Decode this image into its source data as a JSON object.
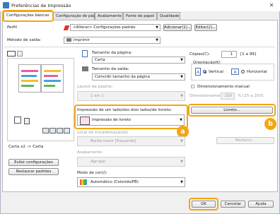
{
  "window": {
    "title": "Preferências de Impressão",
    "close_glyph": "✕"
  },
  "tabs": [
    {
      "label": "Configurações básicas",
      "active": true
    },
    {
      "label": "Configuração de página"
    },
    {
      "label": "Acabamento"
    },
    {
      "label": "Fonte de papel"
    },
    {
      "label": "Qualidade"
    }
  ],
  "profile": {
    "label": "Perfil",
    "value": "<Alterar> Configurações padrão",
    "add_button": "Adicionar(1)...",
    "edit_button": "Editar(2)..."
  },
  "output_method": {
    "label": "Método de saída:",
    "value": "Imprimir"
  },
  "preview": {
    "caption": "Carta x2 -> Carta",
    "settings_view_button": "Exibir configurações",
    "restore_defaults_button": "Restaurar padrões"
  },
  "page_size": {
    "label": "Tamanho da página:",
    "value": "Carta"
  },
  "output_size": {
    "label": "Tamanho da saída:",
    "value": "Coincidir tamanho da página"
  },
  "copies": {
    "label": "Cópias(C):",
    "value": "1",
    "range": "[1 a 99]"
  },
  "orientation": {
    "label": "Orientação(K)",
    "portrait": "Vertical",
    "landscape": "Horizontal",
    "selected": "portrait"
  },
  "page_layout": {
    "label": "Layout da página:",
    "value": "1 em 1"
  },
  "manual_scaling": {
    "label": "Dimensionamento manual",
    "scale_label": "Dimensionamento:",
    "value": "100",
    "range": "% [25 a 200]"
  },
  "duplex": {
    "label": "Impressão de um lado/dos dois lados/de livreto:",
    "value": "Impressão de livreto",
    "booklet_button": "Livreto..."
  },
  "binding": {
    "label": "Local de encadernação(b)",
    "value": "Borda maior [Esquerda]",
    "margin_button": "Medianiz..."
  },
  "finishing": {
    "label": "Acabamento",
    "value": "Agrupar"
  },
  "color_mode": {
    "label": "Modo de cor(/):",
    "value": "Automático (Colorido/PB)"
  },
  "callouts": {
    "a": "a",
    "b": "b"
  },
  "dialog_buttons": {
    "ok": "OK",
    "cancel": "Cancelar",
    "help": "Ajuda"
  }
}
